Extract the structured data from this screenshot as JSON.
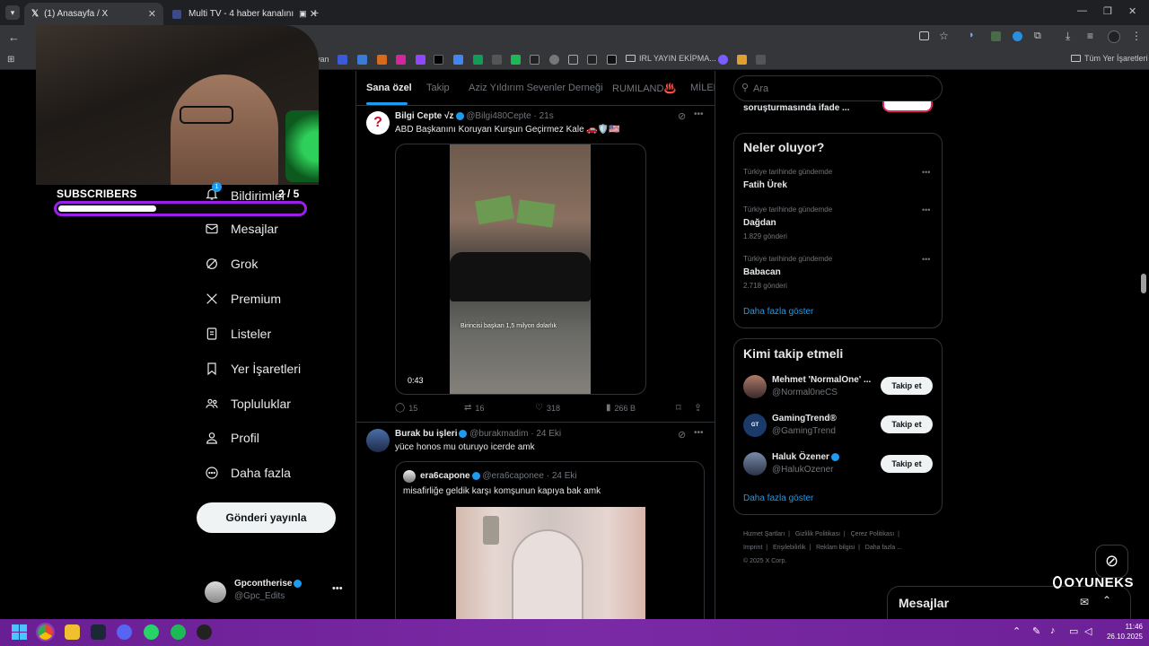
{
  "browser": {
    "tabs": [
      {
        "title": "(1) Anasayfa / X"
      },
      {
        "title": "Multi TV - 4 haber kanalını"
      }
    ],
    "bookmarks_folder": "IRL YAYIN EKİPMA...",
    "all_bookmarks": "Tüm Yer İşaretleri",
    "bookmarks_prefix": "yan"
  },
  "overlay": {
    "subscribers_label": "SUBSCRIBERS",
    "subscribers_count": "2 / 5",
    "progress": 0.4,
    "brand": "OYUNEKS"
  },
  "nav": {
    "items": [
      {
        "label": "Bildirimler",
        "badge": "1"
      },
      {
        "label": "Mesajlar"
      },
      {
        "label": "Grok"
      },
      {
        "label": "Premium"
      },
      {
        "label": "Listeler"
      },
      {
        "label": "Yer İşaretleri"
      },
      {
        "label": "Topluluklar"
      },
      {
        "label": "Profil"
      },
      {
        "label": "Daha fazla"
      }
    ],
    "post_button": "Gönderi yayınla",
    "user_name": "Gpcontherise",
    "user_handle": "@Gpc_Edits"
  },
  "feed": {
    "tabs": [
      "Sana özel",
      "Takip",
      "Aziz Yıldırım Sevenler Derneği",
      "RUMILAND♨️",
      "MİLEN"
    ],
    "tweet1": {
      "name": "Bilgi Cepte √ᴢ",
      "handle": "@Bilgi480Cepte",
      "time": "21s",
      "text": "ABD Başkanını Koruyan Kurşun Geçirmez Kale 🚗🛡️🇺🇸",
      "video_caption": "Birincisi başkan 1,5 milyon dolarlık",
      "duration": "0:43",
      "replies": "15",
      "retweets": "16",
      "likes": "318",
      "views": "266 B"
    },
    "tweet2": {
      "name": "Burak bu işleri",
      "handle": "@burakmadim",
      "time": "24 Eki",
      "text": "yüce honos mu oturuyo icerde amk",
      "quote_name": "era6capone",
      "quote_handle": "@era6caponee",
      "quote_time": "24 Eki",
      "quote_text": "misafirliğe geldik karşı komşunun kapıya bak amk"
    }
  },
  "right": {
    "search_placeholder": "Ara",
    "live_snippet": "soruşturmasında ifade ...",
    "trends_title": "Neler oluyor?",
    "trends": [
      {
        "context": "Türkiye tarihinde gündemde",
        "topic": "Fatih Ürek",
        "count": ""
      },
      {
        "context": "Türkiye tarihinde gündemde",
        "topic": "Dağdan",
        "count": "1.829 gönderi"
      },
      {
        "context": "Türkiye tarihinde gündemde",
        "topic": "Babacan",
        "count": "2.718 gönderi"
      }
    ],
    "trends_more": "Daha fazla göster",
    "follow_title": "Kimi takip etmeli",
    "follow": [
      {
        "name": "Mehmet 'NormalOne' ...",
        "handle": "@Normal0neCS",
        "button": "Takip et"
      },
      {
        "name": "GamingTrend®",
        "handle": "@GamingTrend",
        "button": "Takip et"
      },
      {
        "name": "Haluk Özener",
        "handle": "@HalukOzener",
        "button": "Takip et"
      }
    ],
    "follow_more": "Daha fazla göster",
    "footer": [
      "Hizmet Şartları",
      "Gizlilik Politikası",
      "Çerez Politikası",
      "Imprint",
      "Erişilebilirlik",
      "Reklam bilgisi",
      "Daha fazla ...",
      "© 2025 X Corp."
    ],
    "messages_drawer": "Mesajlar"
  },
  "taskbar": {
    "time": "11:46",
    "date": "26.10.2025"
  },
  "colors": {
    "accent": "#1d9bf0",
    "overlay_purple": "#9b1fe8",
    "taskbar": "#6f2399"
  }
}
